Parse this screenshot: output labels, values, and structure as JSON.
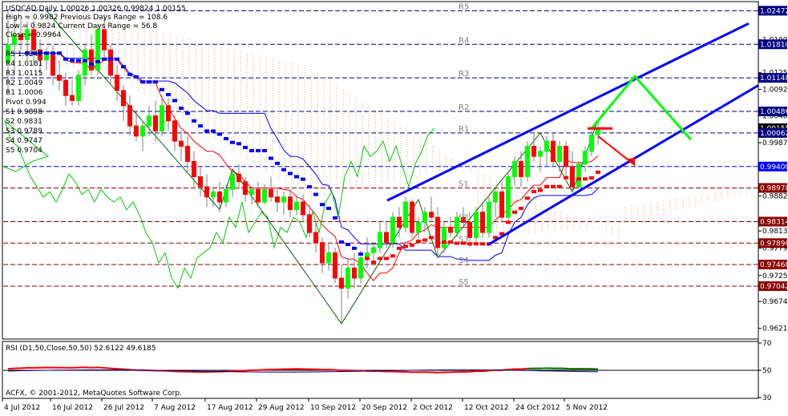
{
  "chart_data": {
    "type": "candlestick",
    "symbol_line": "USDCAD,Daily   1.00026 1.00326 0.99824 1.00155",
    "info_lines": [
      "High = 0.9982    Previous Days Range = 108.6",
      "Low = 0.9824    Current Days Range = 56.8",
      "Close = 0.9964"
    ],
    "pivot_table": [
      "R5 1.0247",
      "R4 1.0181",
      "R3 1.0115",
      "R2 1.0049",
      "R1 1.0006",
      "Pivot 0.994",
      "S1 0.9898",
      "S2 0.9831",
      "S3 0.9789",
      "S4 0.9747",
      "S5 0.9704"
    ],
    "level_labels": [
      "R5",
      "R4",
      "R3",
      "R2",
      "R1",
      "S1",
      "S2",
      "S3",
      "S4",
      "S5"
    ],
    "price_ticks": [
      "1.0247",
      "1.0190",
      "1.0181",
      "1.0125",
      "1.0114",
      "1.0092",
      "1.0048",
      "1.0040",
      "1.0015",
      "1.0006",
      "0.9987",
      "0.9940",
      "0.9897",
      "0.9882",
      "0.9831",
      "0.9813",
      "0.9789",
      "0.9779",
      "0.9746",
      "0.9725",
      "0.9704",
      "0.9674",
      "0.9621"
    ],
    "level_tags": [
      {
        "label": "1.02472",
        "value": 1.02472,
        "color": "#000080",
        "dash": true
      },
      {
        "label": "1.01810",
        "value": 1.0181,
        "color": "#000080",
        "dash": true
      },
      {
        "label": "1.01148",
        "value": 1.01148,
        "color": "#000080",
        "dash": true
      },
      {
        "label": "1.00486",
        "value": 1.00486,
        "color": "#000080",
        "dash": true
      },
      {
        "label": "1.00155",
        "value": 1.00155,
        "color": "#000000",
        "dash": false
      },
      {
        "label": "1.00062",
        "value": 1.00062,
        "color": "#000080",
        "dash": true
      },
      {
        "label": "0.99400",
        "value": 0.994,
        "color": "#0000ff",
        "dash": true
      },
      {
        "label": "0.98978",
        "value": 0.98978,
        "color": "#8b0000",
        "dash": true
      },
      {
        "label": "0.98314",
        "value": 0.98314,
        "color": "#8b0000",
        "dash": true
      },
      {
        "label": "0.97890",
        "value": 0.9789,
        "color": "#8b0000",
        "dash": true
      },
      {
        "label": "0.97468",
        "value": 0.97468,
        "color": "#8b0000",
        "dash": true
      },
      {
        "label": "0.97042",
        "value": 0.97042,
        "color": "#8b0000",
        "dash": true
      }
    ],
    "price_range": [
      0.9603,
      1.0262
    ],
    "x_ticks": [
      "4 Jul 2012",
      "16 Jul 2012",
      "26 Jul 2012",
      "7 Aug 2012",
      "17 Aug 2012",
      "29 Aug 2012",
      "10 Sep 2012",
      "20 Sep 2012",
      "2 Oct 2012",
      "12 Oct 2012",
      "24 Oct 2012",
      "5 Nov 2012"
    ],
    "candles": [
      {
        "o": 1.0145,
        "h": 1.0247,
        "l": 1.008,
        "c": 1.018
      },
      {
        "o": 1.018,
        "h": 1.024,
        "l": 1.012,
        "c": 1.02
      },
      {
        "o": 1.02,
        "h": 1.023,
        "l": 1.017,
        "c": 1.019
      },
      {
        "o": 1.019,
        "h": 1.0225,
        "l": 1.015,
        "c": 1.021
      },
      {
        "o": 1.021,
        "h": 1.0228,
        "l": 1.014,
        "c": 1.017
      },
      {
        "o": 1.017,
        "h": 1.019,
        "l": 1.012,
        "c": 1.015
      },
      {
        "o": 1.015,
        "h": 1.0175,
        "l": 1.013,
        "c": 1.016
      },
      {
        "o": 1.016,
        "h": 1.0178,
        "l": 1.01,
        "c": 1.012
      },
      {
        "o": 1.012,
        "h": 1.015,
        "l": 1.009,
        "c": 1.011
      },
      {
        "o": 1.011,
        "h": 1.0125,
        "l": 1.006,
        "c": 1.008
      },
      {
        "o": 1.008,
        "h": 1.011,
        "l": 1.006,
        "c": 1.007
      },
      {
        "o": 1.007,
        "h": 1.013,
        "l": 1.006,
        "c": 1.012
      },
      {
        "o": 1.012,
        "h": 1.018,
        "l": 1.01,
        "c": 1.017
      },
      {
        "o": 1.017,
        "h": 1.02,
        "l": 1.012,
        "c": 1.013
      },
      {
        "o": 1.013,
        "h": 1.022,
        "l": 1.012,
        "c": 1.021
      },
      {
        "o": 1.021,
        "h": 1.024,
        "l": 1.015,
        "c": 1.017
      },
      {
        "o": 1.017,
        "h": 1.018,
        "l": 1.01,
        "c": 1.012
      },
      {
        "o": 1.012,
        "h": 1.014,
        "l": 1.007,
        "c": 1.009
      },
      {
        "o": 1.009,
        "h": 1.01,
        "l": 1.003,
        "c": 1.006
      },
      {
        "o": 1.006,
        "h": 1.008,
        "l": 1.0,
        "c": 1.002
      },
      {
        "o": 1.002,
        "h": 1.005,
        "l": 0.999,
        "c": 1.0
      },
      {
        "o": 1.0,
        "h": 1.003,
        "l": 0.997,
        "c": 1.002
      },
      {
        "o": 1.002,
        "h": 1.006,
        "l": 1.0,
        "c": 1.004
      },
      {
        "o": 1.004,
        "h": 1.007,
        "l": 0.999,
        "c": 1.001
      },
      {
        "o": 1.001,
        "h": 1.008,
        "l": 1.0,
        "c": 1.006
      },
      {
        "o": 1.006,
        "h": 1.0075,
        "l": 1.001,
        "c": 1.003
      },
      {
        "o": 1.003,
        "h": 1.004,
        "l": 0.997,
        "c": 0.999
      },
      {
        "o": 0.999,
        "h": 1.001,
        "l": 0.995,
        "c": 0.998
      },
      {
        "o": 0.998,
        "h": 1.0,
        "l": 0.993,
        "c": 0.995
      },
      {
        "o": 0.995,
        "h": 0.997,
        "l": 0.99,
        "c": 0.992
      },
      {
        "o": 0.992,
        "h": 0.994,
        "l": 0.988,
        "c": 0.99
      },
      {
        "o": 0.99,
        "h": 0.9925,
        "l": 0.986,
        "c": 0.988
      },
      {
        "o": 0.988,
        "h": 0.99,
        "l": 0.986,
        "c": 0.989
      },
      {
        "o": 0.989,
        "h": 0.991,
        "l": 0.985,
        "c": 0.987
      },
      {
        "o": 0.987,
        "h": 0.9905,
        "l": 0.986,
        "c": 0.9895
      },
      {
        "o": 0.9895,
        "h": 0.9935,
        "l": 0.988,
        "c": 0.9925
      },
      {
        "o": 0.9925,
        "h": 0.9945,
        "l": 0.9895,
        "c": 0.991
      },
      {
        "o": 0.991,
        "h": 0.992,
        "l": 0.987,
        "c": 0.9885
      },
      {
        "o": 0.9885,
        "h": 0.99,
        "l": 0.9865,
        "c": 0.9895
      },
      {
        "o": 0.9895,
        "h": 0.991,
        "l": 0.986,
        "c": 0.987
      },
      {
        "o": 0.987,
        "h": 0.9905,
        "l": 0.9865,
        "c": 0.9895
      },
      {
        "o": 0.9895,
        "h": 0.992,
        "l": 0.987,
        "c": 0.988
      },
      {
        "o": 0.988,
        "h": 0.9895,
        "l": 0.985,
        "c": 0.987
      },
      {
        "o": 0.987,
        "h": 0.989,
        "l": 0.9845,
        "c": 0.988
      },
      {
        "o": 0.988,
        "h": 0.9895,
        "l": 0.984,
        "c": 0.9855
      },
      {
        "o": 0.9855,
        "h": 0.9885,
        "l": 0.9845,
        "c": 0.987
      },
      {
        "o": 0.987,
        "h": 0.9885,
        "l": 0.983,
        "c": 0.9845
      },
      {
        "o": 0.9845,
        "h": 0.9865,
        "l": 0.98,
        "c": 0.981
      },
      {
        "o": 0.981,
        "h": 0.983,
        "l": 0.977,
        "c": 0.979
      },
      {
        "o": 0.979,
        "h": 0.98,
        "l": 0.973,
        "c": 0.975
      },
      {
        "o": 0.975,
        "h": 0.979,
        "l": 0.9735,
        "c": 0.977
      },
      {
        "o": 0.977,
        "h": 0.978,
        "l": 0.971,
        "c": 0.972
      },
      {
        "o": 0.972,
        "h": 0.9745,
        "l": 0.963,
        "c": 0.97
      },
      {
        "o": 0.97,
        "h": 0.976,
        "l": 0.968,
        "c": 0.974
      },
      {
        "o": 0.974,
        "h": 0.977,
        "l": 0.97,
        "c": 0.972
      },
      {
        "o": 0.972,
        "h": 0.9775,
        "l": 0.971,
        "c": 0.976
      },
      {
        "o": 0.976,
        "h": 0.98,
        "l": 0.974,
        "c": 0.977
      },
      {
        "o": 0.977,
        "h": 0.979,
        "l": 0.975,
        "c": 0.978
      },
      {
        "o": 0.978,
        "h": 0.983,
        "l": 0.977,
        "c": 0.981
      },
      {
        "o": 0.981,
        "h": 0.983,
        "l": 0.978,
        "c": 0.979
      },
      {
        "o": 0.979,
        "h": 0.985,
        "l": 0.978,
        "c": 0.984
      },
      {
        "o": 0.984,
        "h": 0.986,
        "l": 0.98,
        "c": 0.982
      },
      {
        "o": 0.982,
        "h": 0.988,
        "l": 0.981,
        "c": 0.987
      },
      {
        "o": 0.987,
        "h": 0.9875,
        "l": 0.98,
        "c": 0.981
      },
      {
        "o": 0.981,
        "h": 0.984,
        "l": 0.979,
        "c": 0.983
      },
      {
        "o": 0.983,
        "h": 0.986,
        "l": 0.981,
        "c": 0.985
      },
      {
        "o": 0.985,
        "h": 0.988,
        "l": 0.983,
        "c": 0.984
      },
      {
        "o": 0.984,
        "h": 0.986,
        "l": 0.976,
        "c": 0.978
      },
      {
        "o": 0.978,
        "h": 0.983,
        "l": 0.977,
        "c": 0.982
      },
      {
        "o": 0.982,
        "h": 0.984,
        "l": 0.98,
        "c": 0.981
      },
      {
        "o": 0.981,
        "h": 0.985,
        "l": 0.98,
        "c": 0.984
      },
      {
        "o": 0.984,
        "h": 0.986,
        "l": 0.982,
        "c": 0.983
      },
      {
        "o": 0.983,
        "h": 0.985,
        "l": 0.978,
        "c": 0.98
      },
      {
        "o": 0.98,
        "h": 0.986,
        "l": 0.979,
        "c": 0.985
      },
      {
        "o": 0.985,
        "h": 0.987,
        "l": 0.98,
        "c": 0.981
      },
      {
        "o": 0.981,
        "h": 0.988,
        "l": 0.98,
        "c": 0.987
      },
      {
        "o": 0.987,
        "h": 0.99,
        "l": 0.984,
        "c": 0.989
      },
      {
        "o": 0.989,
        "h": 0.991,
        "l": 0.983,
        "c": 0.984
      },
      {
        "o": 0.984,
        "h": 0.993,
        "l": 0.983,
        "c": 0.992
      },
      {
        "o": 0.992,
        "h": 0.996,
        "l": 0.99,
        "c": 0.995
      },
      {
        "o": 0.995,
        "h": 0.997,
        "l": 0.99,
        "c": 0.992
      },
      {
        "o": 0.992,
        "h": 0.999,
        "l": 0.991,
        "c": 0.998
      },
      {
        "o": 0.998,
        "h": 1.0006,
        "l": 0.995,
        "c": 0.996
      },
      {
        "o": 0.996,
        "h": 0.998,
        "l": 0.993,
        "c": 0.997
      },
      {
        "o": 0.997,
        "h": 1.0,
        "l": 0.994,
        "c": 0.999
      },
      {
        "o": 0.999,
        "h": 1.0006,
        "l": 0.994,
        "c": 0.995
      },
      {
        "o": 0.995,
        "h": 0.999,
        "l": 0.993,
        "c": 0.998
      },
      {
        "o": 0.998,
        "h": 0.999,
        "l": 0.992,
        "c": 0.994
      },
      {
        "o": 0.994,
        "h": 0.997,
        "l": 0.989,
        "c": 0.99
      },
      {
        "o": 0.99,
        "h": 0.995,
        "l": 0.9895,
        "c": 0.9945
      },
      {
        "o": 0.9945,
        "h": 0.998,
        "l": 0.993,
        "c": 0.997
      },
      {
        "o": 0.997,
        "h": 1.001,
        "l": 0.996,
        "c": 1.0002
      },
      {
        "o": 1.00026,
        "h": 1.00326,
        "l": 0.99824,
        "c": 1.00155
      }
    ],
    "rsi": {
      "label": "RSI (D1,50,Close,50,50) 52.6122 49.6185",
      "axis_ticks": [
        "70",
        "50",
        "30"
      ],
      "range": [
        30,
        70
      ]
    },
    "copyright": "ACFX, © 2001-2012, MetaQuotes Software Corp.",
    "colors": {
      "bull": "#00ff00",
      "bear": "#ff0000",
      "channel": "#0000ff",
      "projection_up": "#00ff00",
      "projection_down": "#ff0000",
      "tenkan": "#ff0000",
      "kijun": "#0000ff",
      "chikou": "#00cc00",
      "cloud": "#d2a679",
      "pivot_marker": "#0000ff",
      "pivot_marker_sell": "#ff0000"
    }
  }
}
